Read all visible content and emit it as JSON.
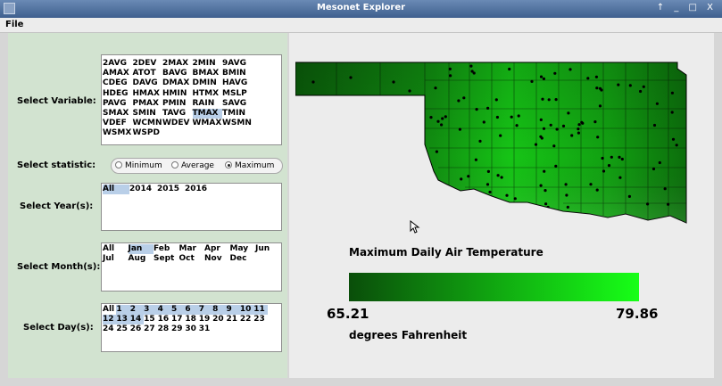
{
  "window": {
    "title": "Mesonet Explorer",
    "controls": "↑ _ □ X"
  },
  "menu": {
    "file": "File"
  },
  "labels": {
    "variable": "Select Variable:",
    "statistic": "Select statistic:",
    "years": "Select Year(s):",
    "months": "Select Month(s):",
    "days": "Select Day(s):"
  },
  "variables": [
    "2AVG",
    "2DEV",
    "2MAX",
    "2MIN",
    "9AVG",
    "AMAX",
    "ATOT",
    "BAVG",
    "BMAX",
    "BMIN",
    "CDEG",
    "DAVG",
    "DMAX",
    "DMIN",
    "HAVG",
    "HDEG",
    "HMAX",
    "HMIN",
    "HTMX",
    "MSLP",
    "PAVG",
    "PMAX",
    "PMIN",
    "RAIN",
    "SAVG",
    "SMAX",
    "SMIN",
    "TAVG",
    "TMAX",
    "TMIN",
    "VDEF",
    "WCMN",
    "WDEV",
    "WMAX",
    "WSMN",
    "WSMX",
    "WSPD"
  ],
  "selected_variable": "TMAX",
  "statistic": {
    "options": [
      "Minimum",
      "Average",
      "Maximum"
    ],
    "selected": "Maximum"
  },
  "years": [
    "All",
    "2014",
    "2015",
    "2016"
  ],
  "selected_years": [
    "All"
  ],
  "months_row1": [
    "All",
    "Jan",
    "Feb",
    "Mar",
    "Apr",
    "May",
    "Jun"
  ],
  "months_row2": [
    "Jul",
    "Aug",
    "Sept",
    "Oct",
    "Nov",
    "Dec"
  ],
  "selected_months": [
    "Jan"
  ],
  "days_row1": [
    "All",
    "1",
    "2",
    "3",
    "4",
    "5",
    "6",
    "7",
    "8",
    "9",
    "10",
    "11"
  ],
  "days_row2": [
    "12",
    "13",
    "14",
    "15",
    "16",
    "17",
    "18",
    "19",
    "20",
    "21",
    "22",
    "23"
  ],
  "days_row3": [
    "24",
    "25",
    "26",
    "27",
    "28",
    "29",
    "30",
    "31"
  ],
  "selected_days": [
    "1",
    "2",
    "3",
    "4",
    "5",
    "6",
    "7",
    "8",
    "9",
    "10",
    "11",
    "12",
    "13",
    "14"
  ],
  "legend": {
    "title": "Maximum Daily Air Temperature",
    "min": "65.21",
    "max": "79.86",
    "units": "degrees Fahrenheit",
    "color_low": "#0a4e0a",
    "color_high": "#17ff17"
  },
  "colors": {
    "titlebar": "#4a6a9a",
    "left_panel": "#d2e3d0",
    "selection": "#b9cfe8"
  },
  "icons": {
    "app": "app-icon",
    "cursor": "mouse-pointer-icon"
  }
}
